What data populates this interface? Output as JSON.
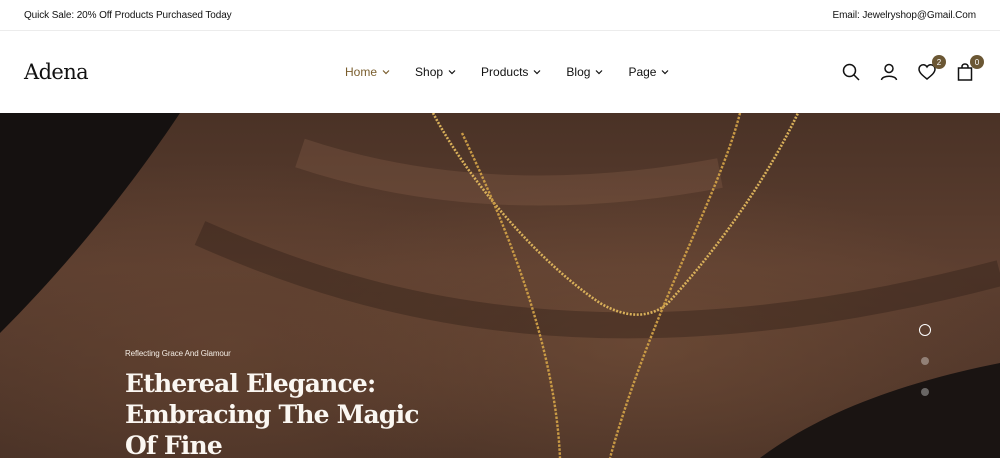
{
  "topbar": {
    "promo": "Quick Sale: 20% Off Products Purchased Today",
    "email": "Email: Jewelryshop@Gmail.Com"
  },
  "header": {
    "logo": "Adena",
    "nav": [
      {
        "label": "Home",
        "active": true
      },
      {
        "label": "Shop",
        "active": false
      },
      {
        "label": "Products",
        "active": false
      },
      {
        "label": "Blog",
        "active": false
      },
      {
        "label": "Page",
        "active": false
      }
    ],
    "icons": [
      "search-icon",
      "user-icon",
      "heart-icon",
      "bag-icon"
    ],
    "wishlist_count": "2",
    "cart_count": "0",
    "accent_color": "#7a5e2e"
  },
  "hero": {
    "kicker": "Reflecting Grace And Glamour",
    "title": "Ethereal Elegance: Embracing The Magic Of Fine",
    "slides": 3,
    "active_slide": 1
  }
}
